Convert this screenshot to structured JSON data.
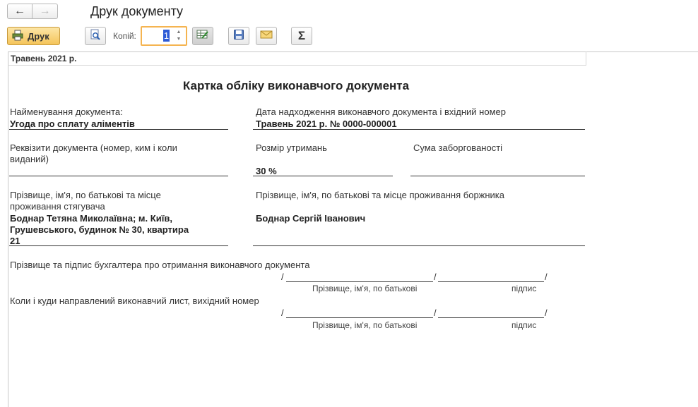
{
  "window": {
    "title": "Друк документу"
  },
  "toolbar": {
    "back_glyph": "←",
    "forward_glyph": "→",
    "print_label": "Друк",
    "copies_label": "Копій:",
    "copies_value": "1",
    "icons": [
      "preview-icon",
      "edit-table-icon",
      "save-icon",
      "email-icon",
      "sum-icon"
    ],
    "sum_glyph": "Σ"
  },
  "document": {
    "header_date": "Травень 2021 р.",
    "title": "Картка обліку виконавчого документа",
    "doc_name_label": "Найменування документа:",
    "doc_name_value": "Угода про сплату аліментів",
    "receipt_label": "Дата надходження виконавчого документа і вхідний номер",
    "receipt_value": "Травень 2021 р. № 0000-000001",
    "requisites_label_1": "Реквізити документа (номер, ким і коли",
    "requisites_label_2": "виданий)",
    "deduction_label": "Розмір утримань",
    "deduction_value": "30 %",
    "debt_label": "Сума заборгованості",
    "claimant_label_1": "Прізвище, ім'я, по батькові та місце",
    "claimant_label_2": "проживання стягувача",
    "claimant_value_1": "Боднар Тетяна Миколаївна; м. Київ,",
    "claimant_value_2": "Грушевського, будинок № 30, квартира",
    "claimant_value_3": "21",
    "debtor_label": "Прізвище, ім'я, по батькові та місце проживання боржника",
    "debtor_value": "Боднар Сергій Іванович",
    "accountant_label": "Прізвище та підпис бухгалтера про отримання виконавчого документа",
    "sent_label": "Коли і куди направлений виконавчий лист, вихідний номер",
    "slash": "/",
    "fio_caption": "Прізвище, ім'я, по батькові",
    "signature_caption": "підпис"
  }
}
